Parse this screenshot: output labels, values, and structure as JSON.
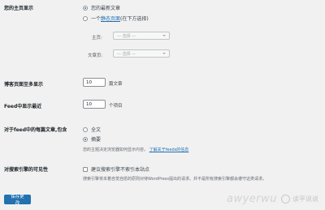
{
  "homepage": {
    "label": "您的主页显示",
    "options": [
      {
        "label": "您的最新文章",
        "checked": true
      },
      {
        "label_prefix": "一个",
        "link": "静态页面",
        "label_suffix": "(在下方选择)",
        "checked": false
      }
    ],
    "homepage_select": {
      "label": "主页:",
      "value": "— 选择 —"
    },
    "posts_page_select": {
      "label": "文章页:",
      "value": "— 选择 —"
    }
  },
  "posts_per_page": {
    "label": "博客页面至多显示",
    "value": "10",
    "unit": "篇文章"
  },
  "feed_items": {
    "label": "Feed中显示最近",
    "value": "10",
    "unit": "个项目"
  },
  "feed_content": {
    "label": "对于feed中的每篇文章,包含",
    "options": [
      {
        "label": "全文",
        "checked": false
      },
      {
        "label": "摘要",
        "checked": true
      }
    ],
    "desc_text": "您的主题决定浏览器如何显示内容。",
    "desc_link": "了解关于feeds的信息"
  },
  "visibility": {
    "label": "对搜索引擎的可见性",
    "checkbox_label": "建议搜索引擎不索引本站点",
    "desc": "搜索引擎将本着自觉自愿的原则对待WordPress提出的请求。并不是所有搜索引擎都会遵守这类请求。"
  },
  "save_button": "保存更改",
  "watermark": {
    "text": "awyerwu",
    "cn": "读平说说"
  },
  "colors": {
    "accent": "#2271b1",
    "background": "#f1f1f1"
  }
}
